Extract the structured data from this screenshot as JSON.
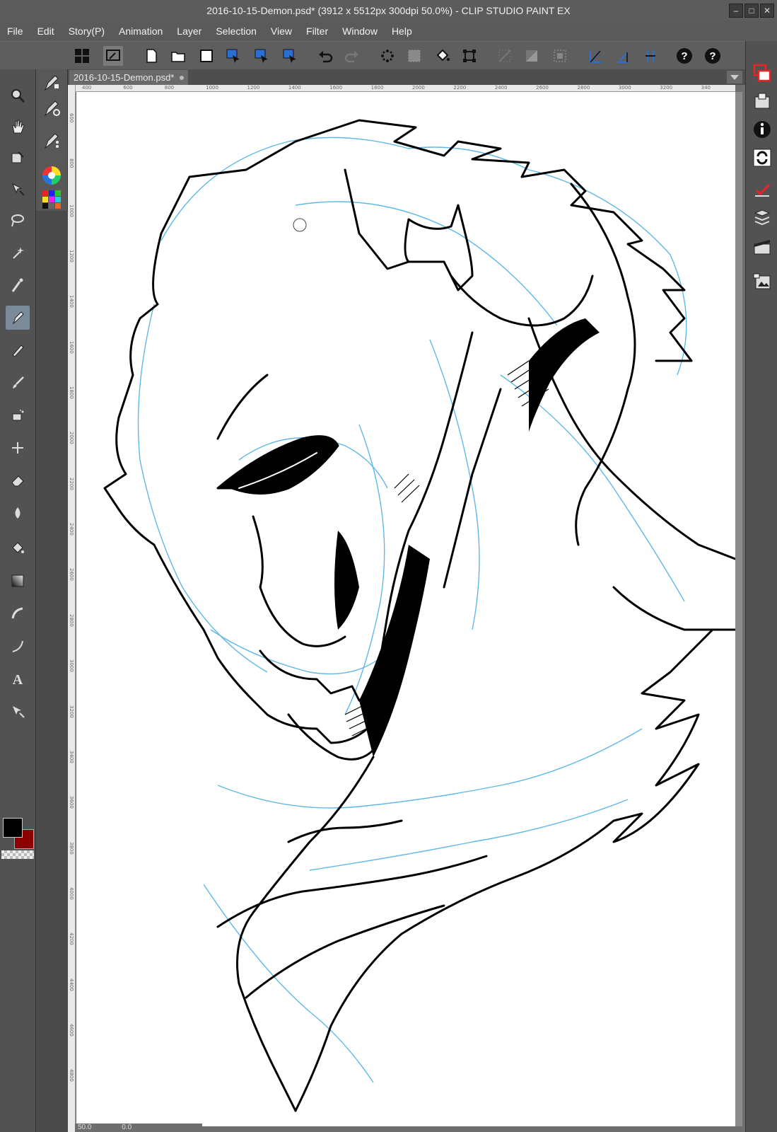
{
  "window": {
    "title": "2016-10-15-Demon.psd* (3912 x 5512px 300dpi 50.0%)  - CLIP STUDIO PAINT EX",
    "controls": [
      "minimize-icon",
      "maximize-icon",
      "close-icon"
    ]
  },
  "menu": [
    "File",
    "Edit",
    "Story(P)",
    "Animation",
    "Layer",
    "Selection",
    "View",
    "Filter",
    "Window",
    "Help"
  ],
  "command_bar": {
    "icons": [
      "grid-icon",
      "navigator-icon",
      "new-icon",
      "open-icon",
      "save-icon",
      "select-layer-icon",
      "select-object-icon",
      "select-move-icon",
      "undo-icon",
      "redo-icon",
      "clear-icon",
      "fill-icon",
      "bucket-icon",
      "transform-icon",
      "deselect-icon",
      "invert-icon",
      "select-all-icon",
      "ruler-snap-icon",
      "special-ruler-snap-icon",
      "grid-snap-icon",
      "help-icon",
      "help2-icon"
    ]
  },
  "document_tab": {
    "label": "2016-10-15-Demon.psd*"
  },
  "ruler": {
    "h_labels": [
      "400",
      "600",
      "800",
      "1000",
      "1200",
      "1400",
      "1600",
      "1800",
      "2000",
      "2200",
      "2400",
      "2600",
      "2800",
      "3000",
      "3200",
      "340"
    ],
    "v_labels": [
      "600",
      "800",
      "1000",
      "1200",
      "1400",
      "1600",
      "1800",
      "2000",
      "2200",
      "2400",
      "2600",
      "2800",
      "3000",
      "3200",
      "3400",
      "3600",
      "3800",
      "4000",
      "4200",
      "4400",
      "4600",
      "4800"
    ]
  },
  "status": {
    "zoom": "50.0",
    "angle": "0.0"
  },
  "tools": [
    "zoom-tool-icon",
    "hand-tool-icon",
    "rotate-icon",
    "move-icon",
    "lasso-icon",
    "magic-wand-icon",
    "eyedropper-icon",
    "pen-icon",
    "pencil-icon",
    "brush-icon",
    "airbrush-icon",
    "decoration-icon",
    "eraser-icon",
    "blend-icon",
    "fill-tool-icon",
    "gradient-icon",
    "figure-icon",
    "curve-icon",
    "text-icon",
    "balloon-icon"
  ],
  "colors": {
    "main": "#000000",
    "sub": "#8b0000",
    "accent": "#7a8a99"
  },
  "dock": [
    "layer-property-icon",
    "navigator-panel-icon",
    "info-icon",
    "sync-icon",
    "auto-action-icon",
    "layer-panel-icon",
    "animation-icon",
    "material-icon"
  ]
}
